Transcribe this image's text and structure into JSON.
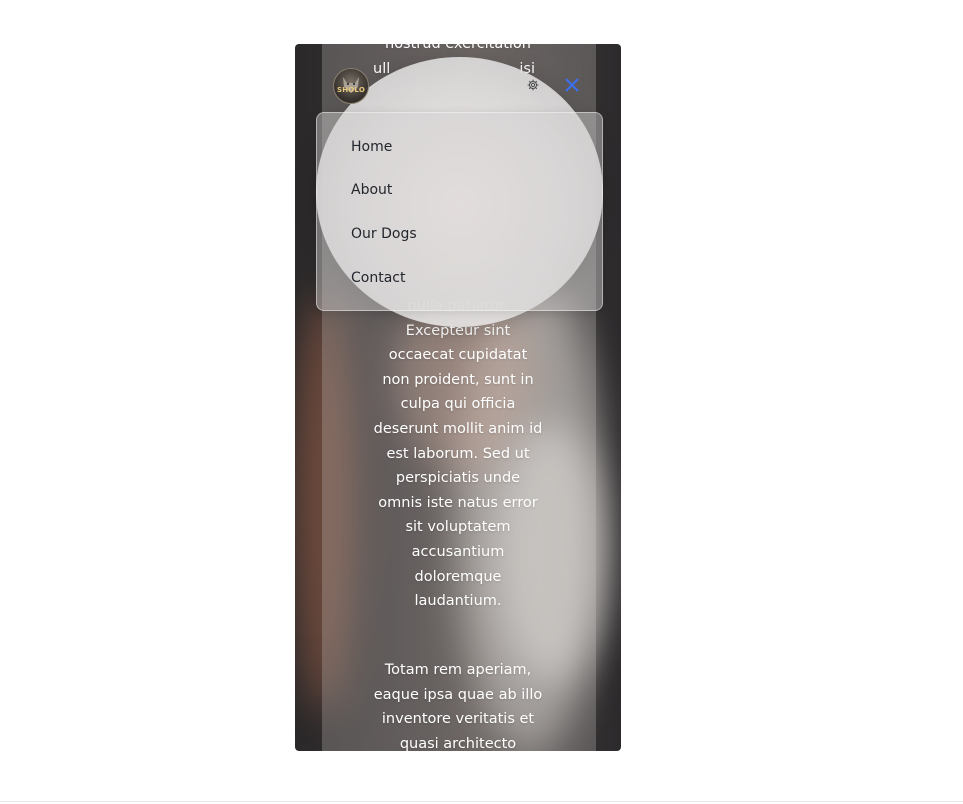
{
  "header": {
    "logo_text": "SHOLO",
    "icons": {
      "settings": "gear-icon",
      "close": "close-icon"
    },
    "close_color": "#3a6ff0"
  },
  "menu": {
    "items": [
      {
        "label": "Home"
      },
      {
        "label": "About"
      },
      {
        "label": "Our Dogs"
      },
      {
        "label": "Contact"
      }
    ]
  },
  "content": {
    "top_lines": [
      "nostrud exercitation",
      "ull",
      "isi"
    ],
    "para1_lines": [
      "nulla pariatur.",
      "Excepteur sint",
      "occaecat cupidatat",
      "non proident, sunt in",
      "culpa qui officia",
      "deserunt mollit anim id",
      "est laborum. Sed ut",
      "perspiciatis unde",
      "omnis iste natus error",
      "sit voluptatem",
      "accusantium",
      "doloremque",
      "laudantium."
    ],
    "para2_lines": [
      "Totam rem aperiam,",
      "eaque ipsa quae ab illo",
      "inventore veritatis et",
      "quasi architecto"
    ]
  }
}
